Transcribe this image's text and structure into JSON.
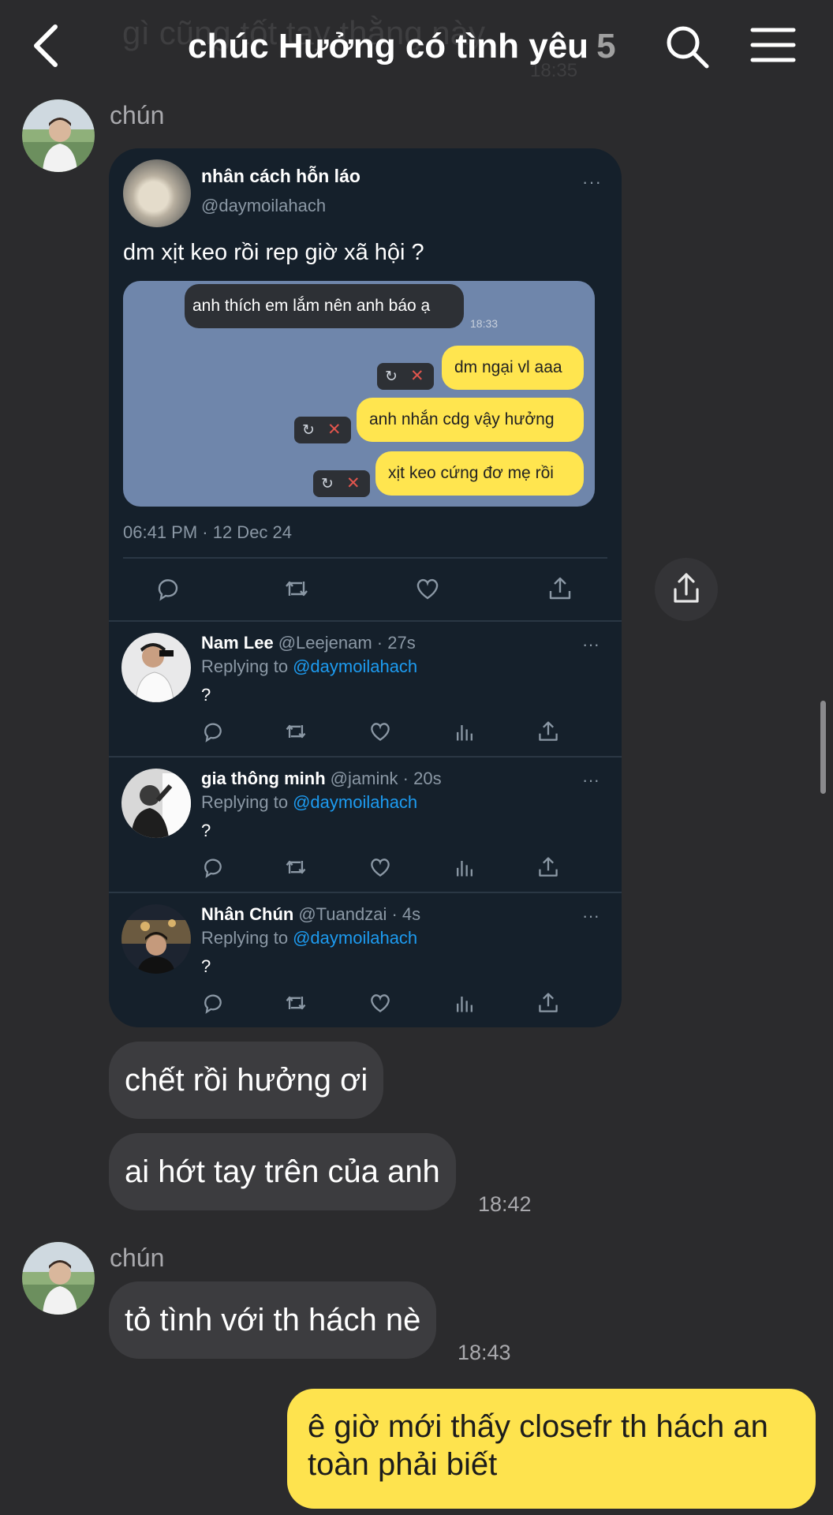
{
  "header": {
    "ghost_text": "gì cũng tốt tay thằng này",
    "ghost_time": "18:35",
    "title": "chúc Hưởng có tình yêu",
    "member_count": "5"
  },
  "messages": {
    "sender_1": "chún",
    "sender_2": "chún",
    "bubble_1": "chết rồi hưởng ơi",
    "bubble_2": "ai hớt tay trên của anh",
    "time_2": "18:42",
    "bubble_3": "tỏ tình với th hách nè",
    "time_3": "18:43",
    "my_message": "ê giờ mới thấy closefr th hách an toàn phải biết"
  },
  "tweet": {
    "name": "nhân cách hỗn láo",
    "handle": "@daymoilahach",
    "text": "dm xịt keo rồi rep giờ xã hội ?",
    "date": "06:41 PM · 12 Dec 24",
    "more": "···",
    "screenshot": {
      "incoming": "anh thích em lắm nên anh báo ạ",
      "incoming_time": "18:33",
      "outgoing": [
        "dm ngại vl aaa",
        "anh nhắn cdg vậy hưởng",
        "xịt keo cứng đơ mẹ rồi"
      ]
    },
    "replies": [
      {
        "name": "Nam Lee",
        "meta": "@Leejenam · 27s",
        "replying": "Replying to",
        "mention": "@daymoilahach",
        "text": "?"
      },
      {
        "name": "gia thông minh",
        "meta": "@jamink · 20s",
        "replying": "Replying to",
        "mention": "@daymoilahach",
        "text": "?"
      },
      {
        "name": "Nhân Chún",
        "meta": "@Tuandzai · 4s",
        "replying": "Replying to",
        "mention": "@daymoilahach",
        "text": "?"
      }
    ]
  },
  "icons": [
    "back-arrow-icon",
    "search-icon",
    "menu-icon",
    "reply-icon",
    "retweet-icon",
    "like-icon",
    "analytics-icon",
    "share-icon"
  ],
  "colors": {
    "background": "#2b2b2d",
    "tweet_card": "#15202b",
    "my_bubble": "#fee34e",
    "other_bubble": "#3c3c3f",
    "link": "#1d9bf0"
  }
}
